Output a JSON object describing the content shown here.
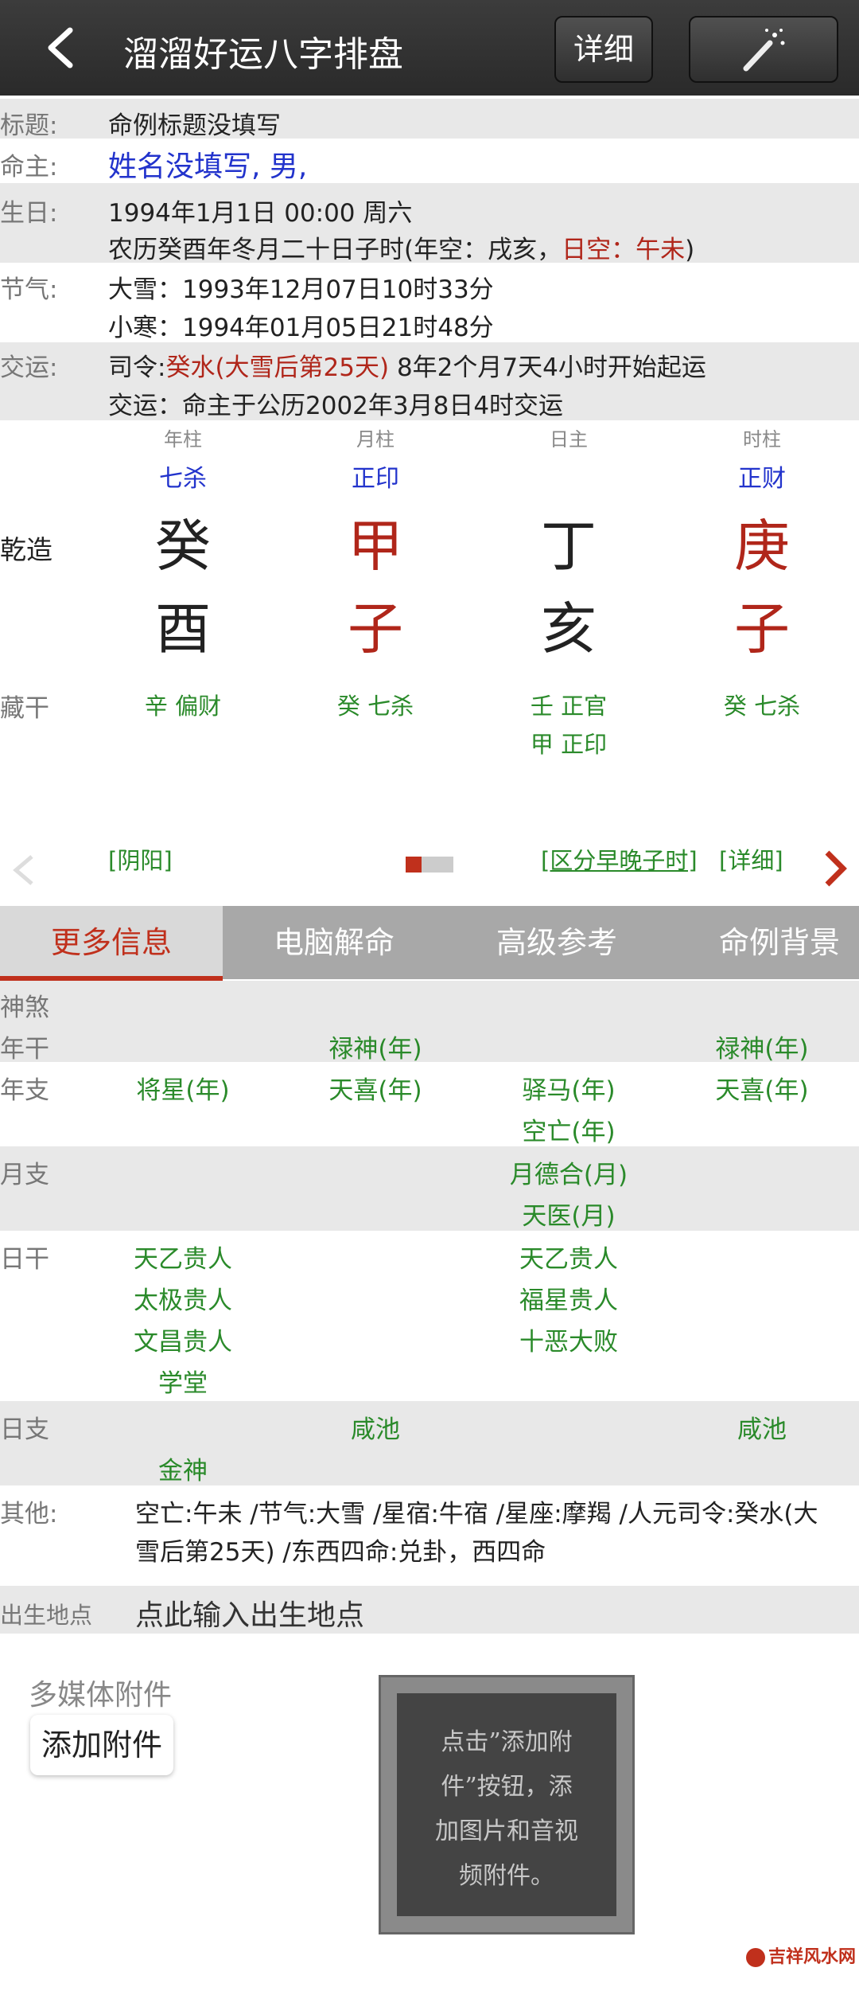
{
  "header": {
    "title": "溜溜好运八字排盘",
    "detail_label": "详细",
    "back_icon": "chevron-left-icon",
    "magic_icon": "magic-wand-icon"
  },
  "info": {
    "title_label": "标题:",
    "title_value": "命例标题没填写",
    "owner_label": "命主:",
    "owner_value": "姓名没填写, 男,",
    "birth_label": "生日:",
    "birth_line1": "1994年1月1日 00:00 周六",
    "birth_line2_a": "农历癸酉年冬月二十日子时(年空：戌亥，",
    "birth_line2_b": "日空：午未",
    "birth_line2_c": ")",
    "jieqi_label": "节气:",
    "jieqi_line1": "大雪：1993年12月07日10时33分",
    "jieqi_line2": "小寒：1994年01月05日21时48分",
    "jiaoyun_label": "交运:",
    "jiaoyun_a": "司令:",
    "jiaoyun_b": "癸水(大雪后第25天)",
    "jiaoyun_c": " 8年2个月7天4小时开始起运",
    "jiaoyun_line2": "交运：命主于公历2002年3月8日4时交运"
  },
  "chart": {
    "row_label": "乾造",
    "cang_label": "藏干",
    "heads": [
      "年柱",
      "月柱",
      "日主",
      "时柱"
    ],
    "shishen": [
      "七杀",
      "正印",
      "",
      "正财"
    ],
    "stems": [
      "癸",
      "甲",
      "丁",
      "庚"
    ],
    "branches": [
      "酉",
      "子",
      "亥",
      "子"
    ],
    "cang": [
      [
        "辛 偏财"
      ],
      [
        "癸 七杀"
      ],
      [
        "壬 正官",
        "甲 正印"
      ],
      [
        "癸 七杀"
      ]
    ],
    "link_yinyang": "[阴阳]",
    "link_zaowan": "[区分早晚子时]",
    "link_detail": "[详细]"
  },
  "tabs": [
    "更多信息",
    "电脑解命",
    "高级参考",
    "命例背景"
  ],
  "shensha": {
    "header": "神煞",
    "rows": [
      {
        "label": "年干",
        "cells": [
          [],
          [
            "禄神(年)"
          ],
          [],
          [
            "禄神(年)"
          ]
        ]
      },
      {
        "label": "年支",
        "cells": [
          [
            "将星(年)"
          ],
          [
            "天喜(年)"
          ],
          [
            "驿马(年)",
            "空亡(年)"
          ],
          [
            "天喜(年)"
          ]
        ]
      },
      {
        "label": "月支",
        "cells": [
          [],
          [],
          [
            "月德合(月)",
            "天医(月)"
          ],
          []
        ]
      },
      {
        "label": "日干",
        "cells": [
          [
            "天乙贵人",
            "太极贵人",
            "文昌贵人",
            "学堂"
          ],
          [],
          [
            "天乙贵人",
            "福星贵人",
            "十恶大败"
          ],
          []
        ]
      },
      {
        "label": "日支",
        "cells": [
          [
            "金神"
          ],
          [
            "咸池"
          ],
          [],
          [
            "咸池"
          ]
        ]
      }
    ],
    "other_label": "其他:",
    "other_line1": "空亡:午未 /节气:大雪 /星宿:牛宿 /星座:摩羯 /人元司令:癸水(大",
    "other_line2": "雪后第25天) /东西四命:兑卦，西四命"
  },
  "birthplace": {
    "label": "出生地点",
    "value": "点此输入出生地点"
  },
  "media": {
    "label": "多媒体附件",
    "add_button": "添加附件",
    "hint_lines": [
      "点击”添加附",
      "件”按钮，添",
      "加图片和音视",
      "频附件。"
    ]
  },
  "watermark": "吉祥风水网"
}
